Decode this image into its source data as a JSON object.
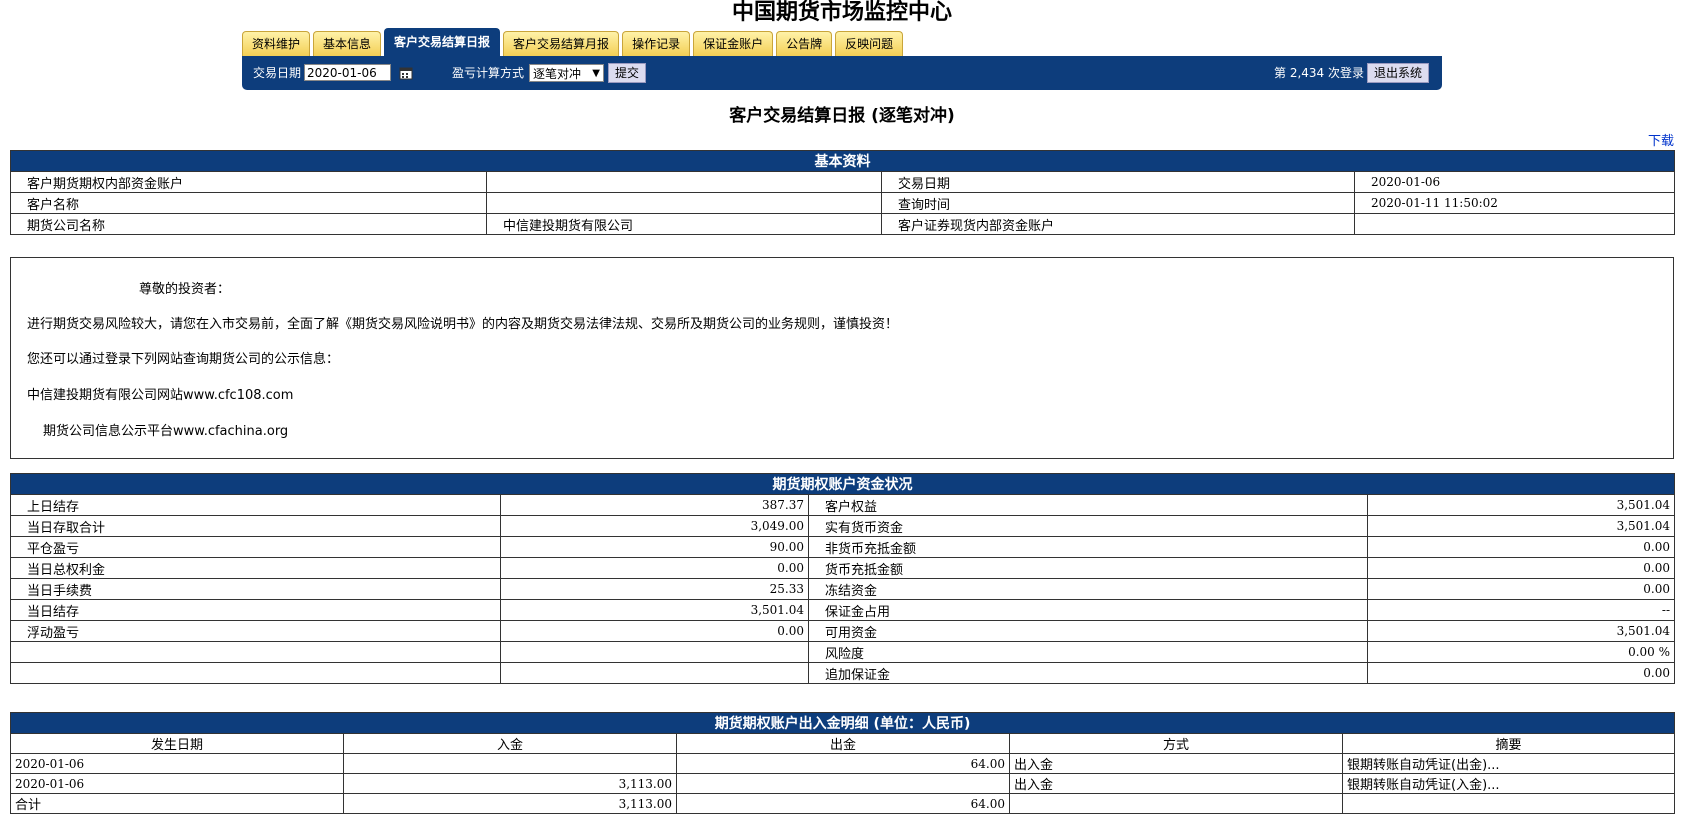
{
  "site_title": "中国期货市场监控中心",
  "tabs": [
    {
      "label": "资料维护",
      "active": false
    },
    {
      "label": "基本信息",
      "active": false
    },
    {
      "label": "客户交易结算日报",
      "active": true
    },
    {
      "label": "客户交易结算月报",
      "active": false
    },
    {
      "label": "操作记录",
      "active": false
    },
    {
      "label": "保证金账户",
      "active": false
    },
    {
      "label": "公告牌",
      "active": false
    },
    {
      "label": "反映问题",
      "active": false
    }
  ],
  "toolbar": {
    "date_label": "交易日期",
    "date_value": "2020-01-06",
    "calc_label": "盈亏计算方式",
    "calc_value": "逐笔对冲",
    "submit_label": "提交",
    "login_count": "第 2,434 次登录",
    "logout_label": "退出系统"
  },
  "report_title": "客户交易结算日报 (逐笔对冲)",
  "download_label": "下载",
  "basic_info": {
    "header": "基本资料",
    "rows": [
      {
        "l1": "客户期货期权内部资金账户",
        "v1": "",
        "l2": "交易日期",
        "v2": "2020-01-06"
      },
      {
        "l1": "客户名称",
        "v1": "",
        "l2": "查询时间",
        "v2": "2020-01-11 11:50:02"
      },
      {
        "l1": "期货公司名称",
        "v1": "中信建投期货有限公司",
        "l2": "客户证券现货内部资金账户",
        "v2": ""
      }
    ]
  },
  "notice": {
    "greeting": "尊敬的投资者：",
    "line1": "进行期货交易风险较大，请您在入市交易前，全面了解《期货交易风险说明书》的内容及期货交易法律法规、交易所及期货公司的业务规则，谨慎投资！",
    "line2": "您还可以通过登录下列网站查询期货公司的公示信息：",
    "line3": "中信建投期货有限公司网站www.cfc108.com",
    "line4": "期货公司信息公示平台www.cfachina.org"
  },
  "funds": {
    "header": "期货期权账户资金状况",
    "rows": [
      {
        "l1": "上日结存",
        "v1": "387.37",
        "l2": "客户权益",
        "v2": "3,501.04"
      },
      {
        "l1": "当日存取合计",
        "v1": "3,049.00",
        "l2": "实有货币资金",
        "v2": "3,501.04"
      },
      {
        "l1": "平仓盈亏",
        "v1": "90.00",
        "l2": "非货币充抵金额",
        "v2": "0.00"
      },
      {
        "l1": "当日总权利金",
        "v1": "0.00",
        "l2": "货币充抵金额",
        "v2": "0.00"
      },
      {
        "l1": "当日手续费",
        "v1": "25.33",
        "l2": "冻结资金",
        "v2": "0.00"
      },
      {
        "l1": "当日结存",
        "v1": "3,501.04",
        "l2": "保证金占用",
        "v2": "--"
      },
      {
        "l1": "浮动盈亏",
        "v1": "0.00",
        "l2": "可用资金",
        "v2": "3,501.04"
      },
      {
        "l1": "",
        "v1": "",
        "l2": "风险度",
        "v2": "0.00 %"
      },
      {
        "l1": "",
        "v1": "",
        "l2": "追加保证金",
        "v2": "0.00"
      }
    ]
  },
  "transfers": {
    "header": "期货期权账户出入金明细 (单位：人民币)",
    "columns": [
      "发生日期",
      "入金",
      "出金",
      "方式",
      "摘要"
    ],
    "rows": [
      {
        "date": "2020-01-06",
        "in": "",
        "out": "64.00",
        "method": "出入金",
        "memo": "银期转账自动凭证(出金)..."
      },
      {
        "date": "2020-01-06",
        "in": "3,113.00",
        "out": "",
        "method": "出入金",
        "memo": "银期转账自动凭证(入金)..."
      }
    ],
    "total": {
      "label": "合计",
      "in": "3,113.00",
      "out": "64.00"
    }
  }
}
